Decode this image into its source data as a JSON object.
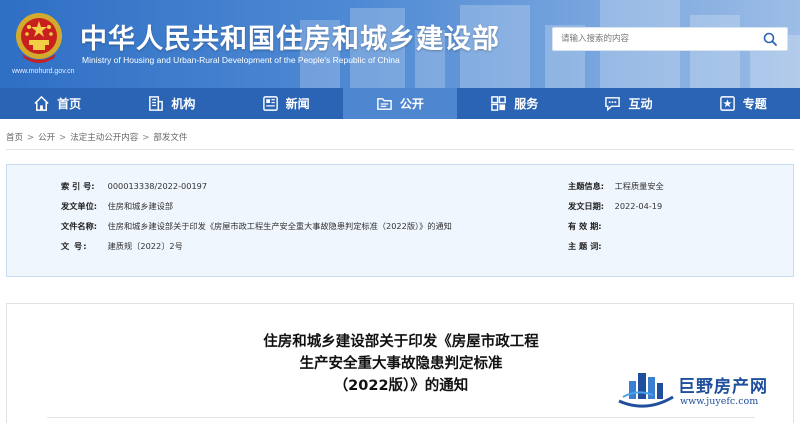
{
  "header": {
    "site_title": "中华人民共和国住房和城乡建设部",
    "site_subtitle": "Ministry of Housing and Urban-Rural Development of the People's Republic of China",
    "site_url": "www.mohurd.gov.cn",
    "search": {
      "placeholder": "请输入搜索的内容"
    }
  },
  "nav": {
    "items": [
      {
        "label": "首页",
        "icon": "home-icon"
      },
      {
        "label": "机构",
        "icon": "building-icon"
      },
      {
        "label": "新闻",
        "icon": "news-icon"
      },
      {
        "label": "公开",
        "icon": "folder-icon",
        "active": true
      },
      {
        "label": "服务",
        "icon": "service-icon"
      },
      {
        "label": "互动",
        "icon": "chat-icon"
      },
      {
        "label": "专题",
        "icon": "star-icon"
      }
    ]
  },
  "breadcrumb": [
    "首页",
    "公开",
    "法定主动公开内容",
    "部发文件"
  ],
  "info": {
    "index_label": "索 引 号:",
    "index_value": "000013338/2022-00197",
    "issuer_label": "发文单位:",
    "issuer_value": "住房和城乡建设部",
    "doc_name_label": "文件名称:",
    "doc_name_value": "住房和城乡建设部关于印发《房屋市政工程生产安全重大事故隐患判定标准（2022版）》的通知",
    "doc_no_label": "文 号:",
    "doc_no_value": "建质规〔2022〕2号",
    "topic_label": "主题信息:",
    "topic_value": "工程质量安全",
    "date_label": "发文日期:",
    "date_value": "2022-04-19",
    "validity_label": "有 效 期:",
    "validity_value": "",
    "keywords_label": "主 题 词:",
    "keywords_value": ""
  },
  "article": {
    "title_line1": "住房和城乡建设部关于印发《房屋市政工程",
    "title_line2": "生产安全重大事故隐患判定标准",
    "title_line3": "（2022版）》的通知"
  },
  "watermark": {
    "name": "巨野房产网",
    "url": "www.juyefc.com"
  },
  "colors": {
    "nav_bg": "#2b64b4",
    "nav_active": "#4f86d0",
    "info_bg": "#f0f6fd",
    "info_border": "#c8dcf2"
  }
}
